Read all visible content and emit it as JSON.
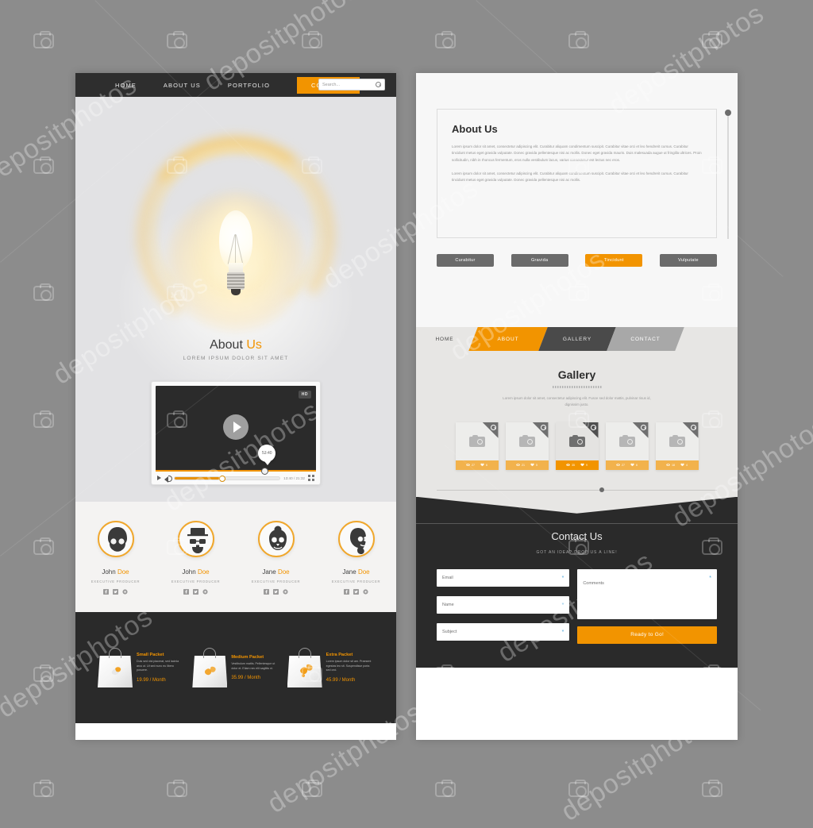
{
  "watermark": {
    "text": "depositphotos",
    "icon": "camera-icon"
  },
  "left_page": {
    "topnav": {
      "items": [
        {
          "label": "HOME",
          "active": false
        },
        {
          "label": "ABOUT US",
          "active": false
        },
        {
          "label": "PORTFOLIO",
          "active": false
        },
        {
          "label": "CONTACT",
          "active": true
        }
      ],
      "search": {
        "placeholder": "Search...",
        "value": "",
        "icon": "search-icon"
      }
    },
    "hero": {
      "image": "glowing-lightbulb",
      "title_main": "About ",
      "title_accent": "Us",
      "subtitle": "LOREM IPSUM DOLOR SIT AMET"
    },
    "player": {
      "quality_badge": "HD",
      "play_icon": "play-icon",
      "tooltip_time": "53:40",
      "time_display": "13:40 / 21:32",
      "progress_percent": 66,
      "volume_percent": 44,
      "fullscreen_icon": "fullscreen-icon",
      "volume_icon": "volume-icon"
    },
    "team": [
      {
        "first": "John ",
        "last": "Doe",
        "role": "EXECUTIVE PRODUCER",
        "avatar": "afro-glasses-beard-avatar"
      },
      {
        "first": "John ",
        "last": "Doe",
        "role": "EXECUTIVE PRODUCER",
        "avatar": "tophat-beard-avatar"
      },
      {
        "first": "Jane ",
        "last": "Doe",
        "role": "EXECUTIVE PRODUCER",
        "avatar": "bun-glasses-avatar"
      },
      {
        "first": "Jane ",
        "last": "Doe",
        "role": "EXECUTIVE PRODUCER",
        "avatar": "long-hair-glasses-avatar"
      }
    ],
    "pricing": [
      {
        "title": "Small Packet",
        "desc": "Duis sed nisl placerat, sed lacinia arcu ut. Ut sed nunc eu libero posuere.",
        "price": "19.99 / Month"
      },
      {
        "title": "Medium Packet",
        "desc": "Vestibulum mattis. Pellentesque ut dolor et. Etiam nec elit sagittis ni.",
        "price": "35.99 / Month"
      },
      {
        "title": "Extra Packet",
        "desc": "Lorem ipsum dolor sit am. Praesent egestas leo sit. Suspendisse porta sed orci.",
        "price": "45.99 / Month"
      }
    ]
  },
  "right_page": {
    "about": {
      "title": "About Us",
      "paragraph1": "Lorem ipsum dolor sit amet, consectetur adipiscing elit. Curabitur aliquam condimentum suscipit. Curabitur vitae orci et leo hendrerit cursus. Curabitur tincidunt metus eget gravida vulputate. Donec gravida pellentesque nisi ac mollis. Donec eget gravida mauris. Duis malesuada augue ut fringilla ultrices. Proin sollicitudin, nibh in rhoncus fermentum, eros nulla vestibulum lacus, varius consectetur est lectus nec eros.",
      "paragraph2": "Lorem ipsum dolor sit amet, consectetur adipiscing elit. Curabitur aliquam condimentum suscipit. Curabitur vitae orci et leo hendrerit cursus. Curabitur tincidunt metus eget gravida vulputate. Donec gravida pellentesque nisi ac mollis.",
      "slider_position_percent": 4
    },
    "tags": [
      {
        "label": "Curabitur",
        "active": false
      },
      {
        "label": "Gravida",
        "active": false
      },
      {
        "label": "Tincidunt",
        "active": true
      },
      {
        "label": "Vulputate",
        "active": false
      }
    ],
    "skewnav": [
      {
        "label": "HOME",
        "state": "plain"
      },
      {
        "label": "ABOUT",
        "state": "active"
      },
      {
        "label": "GALLERY",
        "state": "dark"
      },
      {
        "label": "CONTACT",
        "state": "gray"
      }
    ],
    "gallery": {
      "title": "Gallery",
      "subtitle": "Lorem ipsum dolor sit amet, consectetur adipiscing elit. Fusce sed dolor mattis, pulvinar risus id, dignissim justo.",
      "cards": [
        {
          "icon": "camera-icon",
          "zoom_icon": "zoom-icon",
          "views": "27",
          "comments": "6",
          "featured": false
        },
        {
          "icon": "camera-icon",
          "zoom_icon": "zoom-icon",
          "views": "21",
          "comments": "5",
          "featured": false
        },
        {
          "icon": "camera-icon",
          "zoom_icon": "zoom-icon",
          "views": "35",
          "comments": "9",
          "featured": true
        },
        {
          "icon": "camera-icon",
          "zoom_icon": "zoom-icon",
          "views": "27",
          "comments": "6",
          "featured": false
        },
        {
          "icon": "camera-icon",
          "zoom_icon": "zoom-icon",
          "views": "18",
          "comments": "4",
          "featured": false
        }
      ],
      "carousel_position_percent": 58
    },
    "contact": {
      "title": "Contact Us",
      "subtitle": "GOT AN IDEA? DROP US A LINE!",
      "fields": [
        {
          "label": "Email",
          "required": "*"
        },
        {
          "label": "Name",
          "required": "*"
        },
        {
          "label": "Subject",
          "required": "*"
        }
      ],
      "comments": {
        "label": "Comments",
        "required": "*"
      },
      "submit_label": "Ready to Go!"
    }
  },
  "colors": {
    "accent": "#f29400",
    "accent_light": "#f2b24c",
    "dark": "#2a2a2a",
    "canvas": "#8c8c8c",
    "required": "#4aa3d8"
  }
}
